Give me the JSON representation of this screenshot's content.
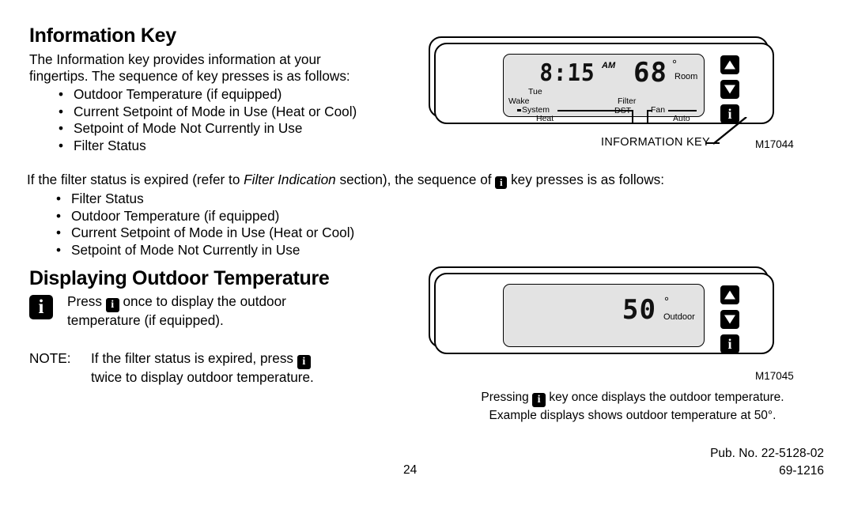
{
  "section1": {
    "title": "Information Key",
    "intro_line1": "The Information key provides information at your",
    "intro_line2": "fingertips. The sequence of key presses is as follows:",
    "bullets": [
      "Outdoor Temperature (if equipped)",
      "Current Setpoint of Mode in Use (Heat or Cool)",
      "Setpoint of Mode Not Currently in Use",
      "Filter Status"
    ],
    "bullet_char": "•"
  },
  "section2": {
    "lead_pre": "If the filter status is expired (refer to ",
    "lead_italic": "Filter Indication",
    "lead_mid": " section), the sequence of ",
    "lead_post": " key presses is as follows:",
    "bullets": [
      "Filter Status",
      "Outdoor Temperature (if equipped)",
      "Current Setpoint of Mode in Use (Heat or Cool)",
      "Setpoint of Mode Not Currently in Use"
    ]
  },
  "section3": {
    "title": "Displaying Outdoor Temperature",
    "press_pre": "Press ",
    "press_post": " once to display the outdoor",
    "press_line2": "temperature (if equipped).",
    "note_label": "NOTE:",
    "note_line1_pre": "If the filter status is expired, press ",
    "note_line2": "twice to display outdoor temperature."
  },
  "device1": {
    "lcd": {
      "clock": "8:15",
      "ampm": "AM",
      "temperature": "68",
      "degree": "°",
      "temp_label": "Room",
      "day": "Tue",
      "period": "Wake",
      "system_label": "System",
      "mode": "Heat",
      "filter_label": "Filter",
      "dst_label": "DST",
      "fan_label": "Fan",
      "fan_mode": "Auto"
    },
    "buttons": {
      "up": "▲",
      "down": "▼",
      "info": "i"
    },
    "callout": "INFORMATION KEY",
    "part_number": "M17044"
  },
  "device2": {
    "lcd": {
      "temperature": "50",
      "degree": "°",
      "temp_label": "Outdoor"
    },
    "buttons": {
      "up": "▲",
      "down": "▼",
      "info": "i"
    },
    "part_number": "M17045",
    "caption_pre": "Pressing ",
    "caption_post": " key once displays the outdoor temperature.",
    "caption_line2": "Example displays shows outdoor temperature at 50°."
  },
  "footer": {
    "page_number": "24",
    "pub_no": "Pub. No. 22-5128-02",
    "doc_no": "69-1216"
  },
  "icons": {
    "info_glyph": "i"
  }
}
